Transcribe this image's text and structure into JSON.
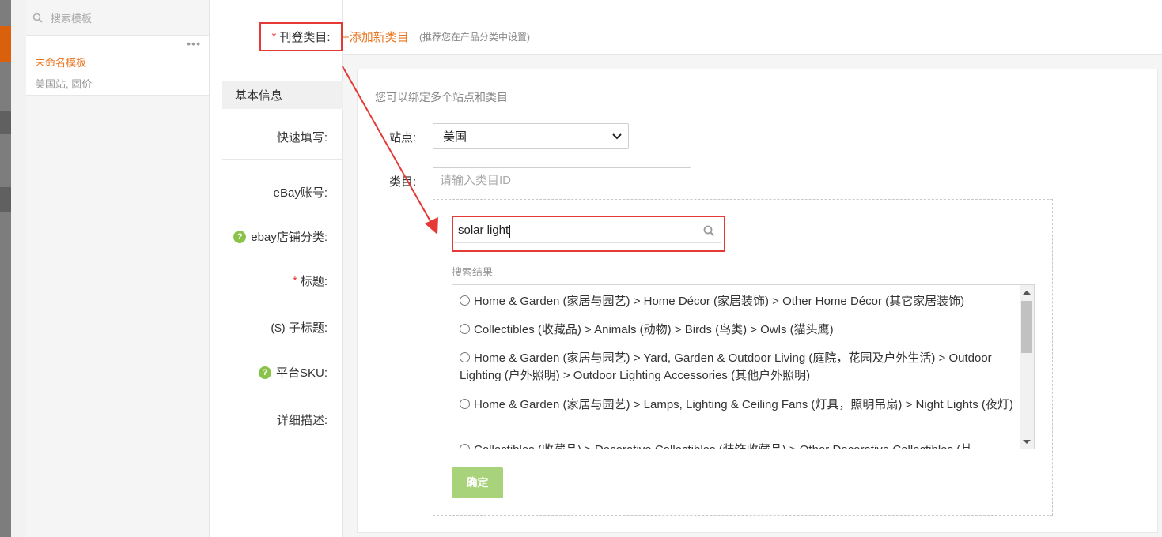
{
  "template_sidebar": {
    "search_placeholder": "搜索模板",
    "items": [
      {
        "name": "未命名模板",
        "desc": "美国站, 固价",
        "more": "•••"
      }
    ]
  },
  "form": {
    "category_label": "刊登类目:",
    "required_mark": "*",
    "add_category": "+添加新类目",
    "add_category_hint": "(推荐您在产品分类中设置)",
    "section_basic": "基本信息",
    "fields": {
      "quick_fill": "快速填写:",
      "ebay_account": "eBay账号:",
      "store_category": "ebay店铺分类:",
      "title": "标题:",
      "subtitle": "($) 子标题:",
      "platform_sku": "平台SKU:",
      "description": "详细描述:"
    },
    "help_icon": "?"
  },
  "category_panel": {
    "intro": "您可以绑定多个站点和类目",
    "site_label": "站点:",
    "site_value": "美国",
    "category_label": "类目:",
    "category_placeholder": "请输入类目ID",
    "search_value": "solar light",
    "results_title": "搜索结果",
    "results": [
      "Home & Garden (家居与园艺) > Home Décor (家居装饰) > Other Home Décor (其它家居装饰)",
      "Collectibles (收藏品) > Animals (动物) > Birds (鸟类) > Owls (猫头鹰)",
      "Home & Garden (家居与园艺) > Yard, Garden & Outdoor Living (庭院，花园及户外生活) > Outdoor Lighting (户外照明) > Outdoor Lighting Accessories (其他户外照明)",
      "Home & Garden (家居与园艺) > Lamps, Lighting & Ceiling Fans (灯具，照明吊扇) > Night Lights (夜灯)",
      "Collectibles (收藏品) > Decorative Collectibles (装饰收藏品) > Other Decorative Collectibles (其"
    ],
    "confirm_label": "确定"
  },
  "colors": {
    "accent_orange": "#e8731d",
    "highlight_red": "#e53935",
    "confirm_green": "#a8d37a",
    "help_green": "#8bc34a"
  }
}
